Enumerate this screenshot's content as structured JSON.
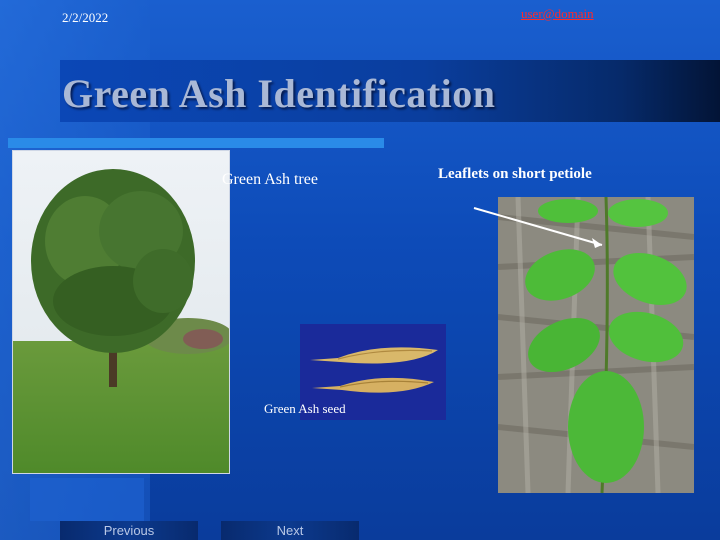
{
  "header": {
    "date": "2/2/2022",
    "email": "user@domain"
  },
  "slide": {
    "title": "Green Ash Identification",
    "tree_caption": "Green Ash tree",
    "seed_caption": "Green Ash seed",
    "leaflet_caption": "Leaflets on short petiole"
  },
  "nav": {
    "previous_label": "Previous",
    "next_label": "Next"
  },
  "colors": {
    "background": "#0d4bb8",
    "email_link": "#ff2a2a",
    "title_text": "#a9b8d6",
    "accent_line": "#2a8be8"
  }
}
